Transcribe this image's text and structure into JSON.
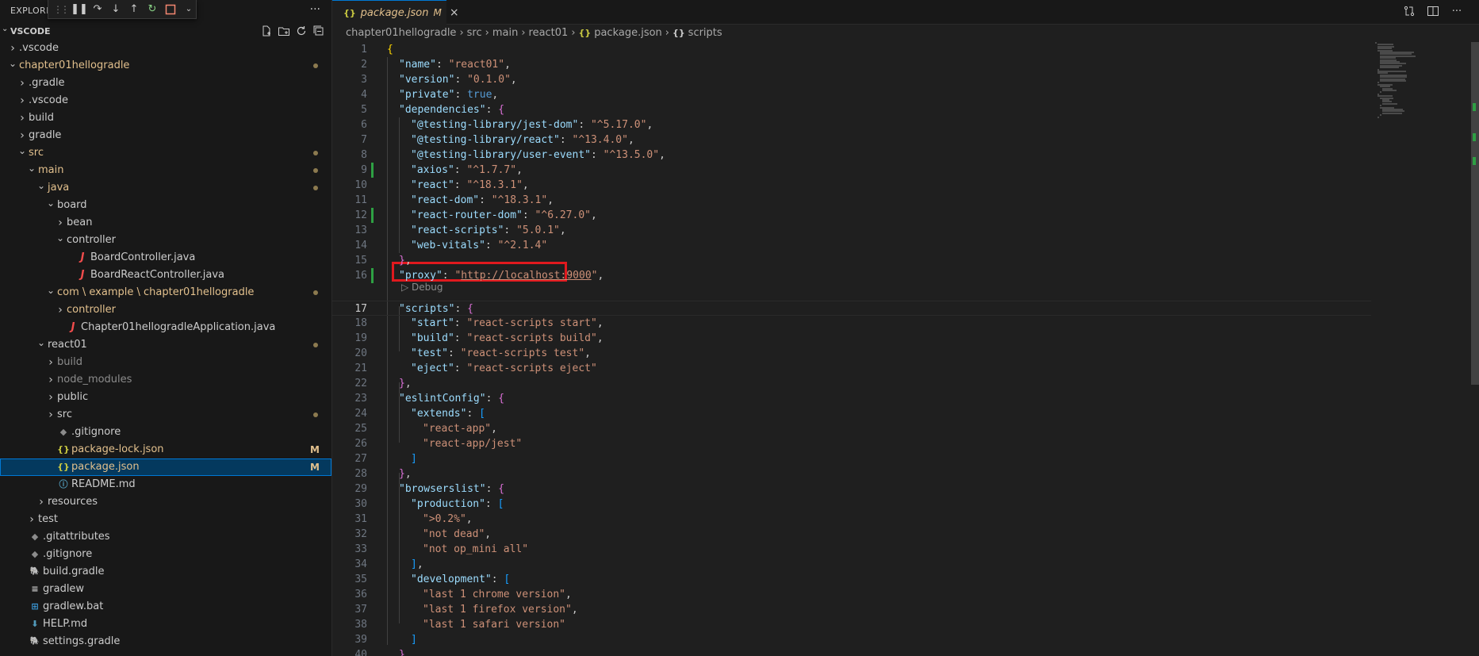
{
  "explorer": {
    "title": "EXPLORER",
    "more_glyph": "···",
    "section_title": "VSCODE",
    "tree": [
      {
        "label": ".vscode",
        "indent": 0,
        "kind": "folder",
        "expanded": false,
        "color": "def"
      },
      {
        "label": "chapter01hellogradle",
        "indent": 0,
        "kind": "folder",
        "expanded": true,
        "color": "mod",
        "dot": true
      },
      {
        "label": ".gradle",
        "indent": 1,
        "kind": "folder",
        "expanded": false,
        "color": "def"
      },
      {
        "label": ".vscode",
        "indent": 1,
        "kind": "folder",
        "expanded": false,
        "color": "def"
      },
      {
        "label": "build",
        "indent": 1,
        "kind": "folder",
        "expanded": false,
        "color": "def"
      },
      {
        "label": "gradle",
        "indent": 1,
        "kind": "folder",
        "expanded": false,
        "color": "def"
      },
      {
        "label": "src",
        "indent": 1,
        "kind": "folder",
        "expanded": true,
        "color": "mod",
        "dot": true
      },
      {
        "label": "main",
        "indent": 2,
        "kind": "folder",
        "expanded": true,
        "color": "mod",
        "dot": true
      },
      {
        "label": "java",
        "indent": 3,
        "kind": "folder",
        "expanded": true,
        "color": "mod",
        "dot": true
      },
      {
        "label": "board",
        "indent": 4,
        "kind": "folder",
        "expanded": true,
        "color": "def"
      },
      {
        "label": "bean",
        "indent": 5,
        "kind": "folder",
        "expanded": false,
        "color": "def"
      },
      {
        "label": "controller",
        "indent": 5,
        "kind": "folder",
        "expanded": true,
        "color": "def"
      },
      {
        "label": "BoardController.java",
        "indent": 6,
        "kind": "java",
        "color": "def"
      },
      {
        "label": "BoardReactController.java",
        "indent": 6,
        "kind": "java",
        "color": "def"
      },
      {
        "label": "com \\ example \\ chapter01hellogradle",
        "indent": 4,
        "kind": "folder",
        "expanded": true,
        "color": "mod",
        "dot": true
      },
      {
        "label": "controller",
        "indent": 5,
        "kind": "folder",
        "expanded": false,
        "color": "mod"
      },
      {
        "label": "Chapter01hellogradleApplication.java",
        "indent": 5,
        "kind": "java",
        "color": "def"
      },
      {
        "label": "react01",
        "indent": 3,
        "kind": "folder",
        "expanded": true,
        "color": "def",
        "dot": true
      },
      {
        "label": "build",
        "indent": 4,
        "kind": "folder",
        "expanded": false,
        "color": "ign"
      },
      {
        "label": "node_modules",
        "indent": 4,
        "kind": "folder",
        "expanded": false,
        "color": "ign"
      },
      {
        "label": "public",
        "indent": 4,
        "kind": "folder",
        "expanded": false,
        "color": "def"
      },
      {
        "label": "src",
        "indent": 4,
        "kind": "folder",
        "expanded": false,
        "color": "def",
        "dot": true
      },
      {
        "label": ".gitignore",
        "indent": 4,
        "kind": "git",
        "color": "def"
      },
      {
        "label": "package-lock.json",
        "indent": 4,
        "kind": "json",
        "color": "mod",
        "badge": "M"
      },
      {
        "label": "package.json",
        "indent": 4,
        "kind": "json",
        "color": "mod",
        "badge": "M",
        "selected": true
      },
      {
        "label": "README.md",
        "indent": 4,
        "kind": "info",
        "color": "def"
      },
      {
        "label": "resources",
        "indent": 3,
        "kind": "folder",
        "expanded": false,
        "color": "def"
      },
      {
        "label": "test",
        "indent": 2,
        "kind": "folder",
        "expanded": false,
        "color": "def"
      },
      {
        "label": ".gitattributes",
        "indent": 1,
        "kind": "git",
        "color": "def"
      },
      {
        "label": ".gitignore",
        "indent": 1,
        "kind": "git",
        "color": "def"
      },
      {
        "label": "build.gradle",
        "indent": 1,
        "kind": "gradle",
        "color": "def"
      },
      {
        "label": "gradlew",
        "indent": 1,
        "kind": "lines",
        "color": "def"
      },
      {
        "label": "gradlew.bat",
        "indent": 1,
        "kind": "win",
        "color": "def"
      },
      {
        "label": "HELP.md",
        "indent": 1,
        "kind": "md",
        "color": "def"
      },
      {
        "label": "settings.gradle",
        "indent": 1,
        "kind": "gradle",
        "color": "def"
      }
    ]
  },
  "tab": {
    "icon": "{}",
    "name": "package.json",
    "status": "M",
    "close": "×"
  },
  "breadcrumbs": [
    "chapter01hellogradle",
    "src",
    "main",
    "react01",
    "package.json",
    "scripts"
  ],
  "codelens": "Debug",
  "current_line": 17,
  "modified_lines": [
    9,
    12,
    16
  ],
  "code_lines": [
    {
      "n": 1,
      "indent": 0,
      "tokens": [
        [
          "b1",
          "{"
        ]
      ]
    },
    {
      "n": 2,
      "indent": 1,
      "tokens": [
        [
          "k",
          "\"name\""
        ],
        [
          "p",
          ": "
        ],
        [
          "s",
          "\"react01\""
        ],
        [
          "p",
          ","
        ]
      ]
    },
    {
      "n": 3,
      "indent": 1,
      "tokens": [
        [
          "k",
          "\"version\""
        ],
        [
          "p",
          ": "
        ],
        [
          "s",
          "\"0.1.0\""
        ],
        [
          "p",
          ","
        ]
      ]
    },
    {
      "n": 4,
      "indent": 1,
      "tokens": [
        [
          "k",
          "\"private\""
        ],
        [
          "p",
          ": "
        ],
        [
          "bool",
          "true"
        ],
        [
          "p",
          ","
        ]
      ]
    },
    {
      "n": 5,
      "indent": 1,
      "tokens": [
        [
          "k",
          "\"dependencies\""
        ],
        [
          "p",
          ": "
        ],
        [
          "b2",
          "{"
        ]
      ]
    },
    {
      "n": 6,
      "indent": 2,
      "tokens": [
        [
          "k",
          "\"@testing-library/jest-dom\""
        ],
        [
          "p",
          ": "
        ],
        [
          "s",
          "\"^5.17.0\""
        ],
        [
          "p",
          ","
        ]
      ]
    },
    {
      "n": 7,
      "indent": 2,
      "tokens": [
        [
          "k",
          "\"@testing-library/react\""
        ],
        [
          "p",
          ": "
        ],
        [
          "s",
          "\"^13.4.0\""
        ],
        [
          "p",
          ","
        ]
      ]
    },
    {
      "n": 8,
      "indent": 2,
      "tokens": [
        [
          "k",
          "\"@testing-library/user-event\""
        ],
        [
          "p",
          ": "
        ],
        [
          "s",
          "\"^13.5.0\""
        ],
        [
          "p",
          ","
        ]
      ]
    },
    {
      "n": 9,
      "indent": 2,
      "tokens": [
        [
          "k",
          "\"axios\""
        ],
        [
          "p",
          ": "
        ],
        [
          "s",
          "\"^1.7.7\""
        ],
        [
          "p",
          ","
        ]
      ]
    },
    {
      "n": 10,
      "indent": 2,
      "tokens": [
        [
          "k",
          "\"react\""
        ],
        [
          "p",
          ": "
        ],
        [
          "s",
          "\"^18.3.1\""
        ],
        [
          "p",
          ","
        ]
      ]
    },
    {
      "n": 11,
      "indent": 2,
      "tokens": [
        [
          "k",
          "\"react-dom\""
        ],
        [
          "p",
          ": "
        ],
        [
          "s",
          "\"^18.3.1\""
        ],
        [
          "p",
          ","
        ]
      ]
    },
    {
      "n": 12,
      "indent": 2,
      "tokens": [
        [
          "k",
          "\"react-router-dom\""
        ],
        [
          "p",
          ": "
        ],
        [
          "s",
          "\"^6.27.0\""
        ],
        [
          "p",
          ","
        ]
      ]
    },
    {
      "n": 13,
      "indent": 2,
      "tokens": [
        [
          "k",
          "\"react-scripts\""
        ],
        [
          "p",
          ": "
        ],
        [
          "s",
          "\"5.0.1\""
        ],
        [
          "p",
          ","
        ]
      ]
    },
    {
      "n": 14,
      "indent": 2,
      "tokens": [
        [
          "k",
          "\"web-vitals\""
        ],
        [
          "p",
          ": "
        ],
        [
          "s",
          "\"^2.1.4\""
        ]
      ]
    },
    {
      "n": 15,
      "indent": 1,
      "tokens": [
        [
          "b2",
          "}"
        ],
        [
          "p",
          ","
        ]
      ]
    },
    {
      "n": 16,
      "indent": 1,
      "tokens": [
        [
          "k",
          "\"proxy\""
        ],
        [
          "p",
          ": "
        ],
        [
          "s",
          "\""
        ],
        [
          "surl",
          "http://localhost:9000"
        ],
        [
          "s",
          "\""
        ],
        [
          "p",
          ","
        ]
      ]
    },
    {
      "n": 17,
      "indent": 1,
      "tokens": [
        [
          "k",
          "\"scripts\""
        ],
        [
          "p",
          ": "
        ],
        [
          "b2",
          "{"
        ]
      ]
    },
    {
      "n": 18,
      "indent": 2,
      "tokens": [
        [
          "k",
          "\"start\""
        ],
        [
          "p",
          ": "
        ],
        [
          "s",
          "\"react-scripts start\""
        ],
        [
          "p",
          ","
        ]
      ]
    },
    {
      "n": 19,
      "indent": 2,
      "tokens": [
        [
          "k",
          "\"build\""
        ],
        [
          "p",
          ": "
        ],
        [
          "s",
          "\"react-scripts build\""
        ],
        [
          "p",
          ","
        ]
      ]
    },
    {
      "n": 20,
      "indent": 2,
      "tokens": [
        [
          "k",
          "\"test\""
        ],
        [
          "p",
          ": "
        ],
        [
          "s",
          "\"react-scripts test\""
        ],
        [
          "p",
          ","
        ]
      ]
    },
    {
      "n": 21,
      "indent": 2,
      "tokens": [
        [
          "k",
          "\"eject\""
        ],
        [
          "p",
          ": "
        ],
        [
          "s",
          "\"react-scripts eject\""
        ]
      ]
    },
    {
      "n": 22,
      "indent": 1,
      "tokens": [
        [
          "b2",
          "}"
        ],
        [
          "p",
          ","
        ]
      ]
    },
    {
      "n": 23,
      "indent": 1,
      "tokens": [
        [
          "k",
          "\"eslintConfig\""
        ],
        [
          "p",
          ": "
        ],
        [
          "b2",
          "{"
        ]
      ]
    },
    {
      "n": 24,
      "indent": 2,
      "tokens": [
        [
          "k",
          "\"extends\""
        ],
        [
          "p",
          ": "
        ],
        [
          "b3",
          "["
        ]
      ]
    },
    {
      "n": 25,
      "indent": 3,
      "tokens": [
        [
          "s",
          "\"react-app\""
        ],
        [
          "p",
          ","
        ]
      ]
    },
    {
      "n": 26,
      "indent": 3,
      "tokens": [
        [
          "s",
          "\"react-app/jest\""
        ]
      ]
    },
    {
      "n": 27,
      "indent": 2,
      "tokens": [
        [
          "b3",
          "]"
        ]
      ]
    },
    {
      "n": 28,
      "indent": 1,
      "tokens": [
        [
          "b2",
          "}"
        ],
        [
          "p",
          ","
        ]
      ]
    },
    {
      "n": 29,
      "indent": 1,
      "tokens": [
        [
          "k",
          "\"browserslist\""
        ],
        [
          "p",
          ": "
        ],
        [
          "b2",
          "{"
        ]
      ]
    },
    {
      "n": 30,
      "indent": 2,
      "tokens": [
        [
          "k",
          "\"production\""
        ],
        [
          "p",
          ": "
        ],
        [
          "b3",
          "["
        ]
      ]
    },
    {
      "n": 31,
      "indent": 3,
      "tokens": [
        [
          "s",
          "\">0.2%\""
        ],
        [
          "p",
          ","
        ]
      ]
    },
    {
      "n": 32,
      "indent": 3,
      "tokens": [
        [
          "s",
          "\"not dead\""
        ],
        [
          "p",
          ","
        ]
      ]
    },
    {
      "n": 33,
      "indent": 3,
      "tokens": [
        [
          "s",
          "\"not op_mini all\""
        ]
      ]
    },
    {
      "n": 34,
      "indent": 2,
      "tokens": [
        [
          "b3",
          "]"
        ],
        [
          "p",
          ","
        ]
      ]
    },
    {
      "n": 35,
      "indent": 2,
      "tokens": [
        [
          "k",
          "\"development\""
        ],
        [
          "p",
          ": "
        ],
        [
          "b3",
          "["
        ]
      ]
    },
    {
      "n": 36,
      "indent": 3,
      "tokens": [
        [
          "s",
          "\"last 1 chrome version\""
        ],
        [
          "p",
          ","
        ]
      ]
    },
    {
      "n": 37,
      "indent": 3,
      "tokens": [
        [
          "s",
          "\"last 1 firefox version\""
        ],
        [
          "p",
          ","
        ]
      ]
    },
    {
      "n": 38,
      "indent": 3,
      "tokens": [
        [
          "s",
          "\"last 1 safari version\""
        ]
      ]
    },
    {
      "n": 39,
      "indent": 2,
      "tokens": [
        [
          "b3",
          "]"
        ]
      ]
    },
    {
      "n": 40,
      "indent": 1,
      "tokens": [
        [
          "b2",
          "}"
        ]
      ]
    }
  ],
  "colors": {
    "accent": "#0078d4",
    "modified": "#e2c08d",
    "gutter_added": "#2ea043",
    "highlight_box": "#e0191e"
  }
}
